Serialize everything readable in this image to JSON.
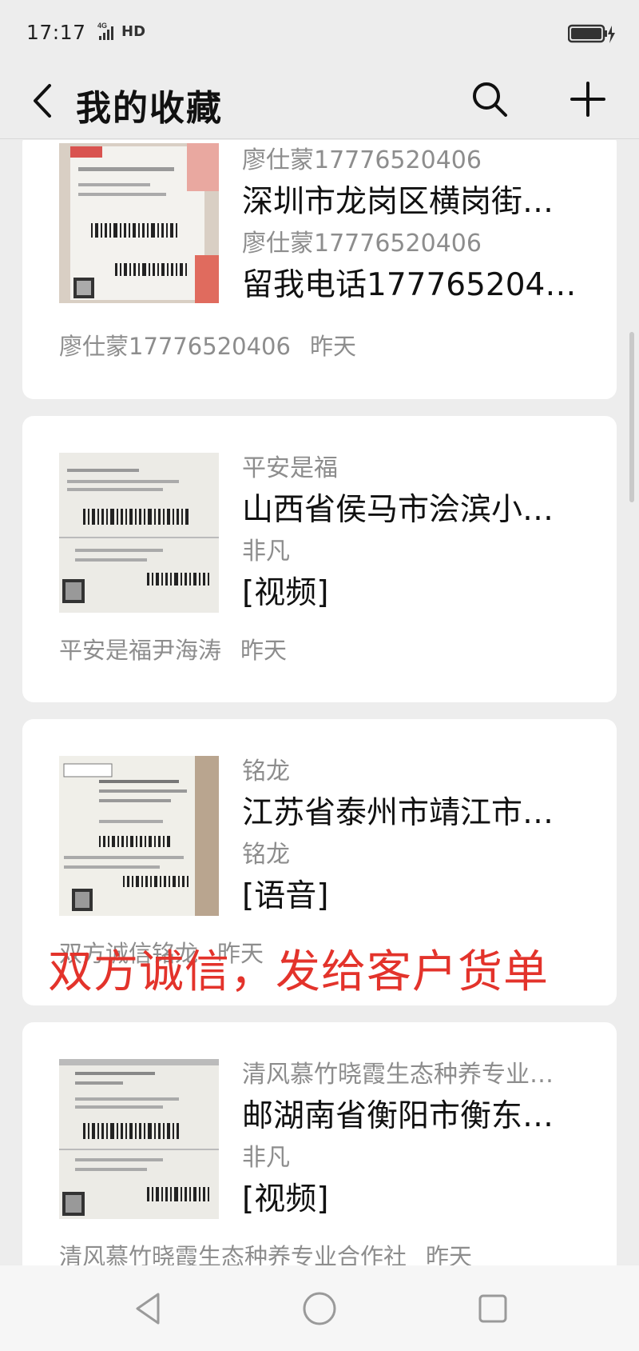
{
  "status_bar": {
    "time": "17:17",
    "network_badge": "4G",
    "network_label": "HD",
    "battery_icon": "battery-charging-icon"
  },
  "header": {
    "title": "我的收藏",
    "back_icon": "back-arrow-icon",
    "search_icon": "search-icon",
    "add_icon": "plus-icon"
  },
  "favorites": [
    {
      "thumbnail_icon": "express-waybill-thumbnail",
      "lines": [
        {
          "text": "廖仕蒙17776520406",
          "style": "sub"
        },
        {
          "text": "深圳市龙岗区横岗街…",
          "style": "main"
        },
        {
          "text": "廖仕蒙17776520406",
          "style": "sub"
        },
        {
          "text": "留我电话177765204…",
          "style": "main"
        }
      ],
      "source": "廖仕蒙17776520406",
      "time": "昨天"
    },
    {
      "thumbnail_icon": "express-waybill-thumbnail",
      "lines": [
        {
          "text": "平安是福",
          "style": "sub"
        },
        {
          "text": "山西省侯马市浍滨小…",
          "style": "main"
        },
        {
          "text": "非凡",
          "style": "sub"
        },
        {
          "text": "[视频]",
          "style": "main"
        }
      ],
      "source": "平安是福尹海涛",
      "time": "昨天"
    },
    {
      "thumbnail_icon": "express-waybill-thumbnail",
      "lines": [
        {
          "text": "铭龙",
          "style": "sub"
        },
        {
          "text": "江苏省泰州市靖江市…",
          "style": "main"
        },
        {
          "text": "铭龙",
          "style": "sub"
        },
        {
          "text": "[语音]",
          "style": "main"
        }
      ],
      "source": "双方诚信铭龙",
      "time": "昨天"
    },
    {
      "thumbnail_icon": "express-waybill-thumbnail",
      "lines": [
        {
          "text": "清风慕竹晓霞生态种养专业…",
          "style": "sub"
        },
        {
          "text": "邮湖南省衡阳市衡东…",
          "style": "main"
        },
        {
          "text": "非凡",
          "style": "sub"
        },
        {
          "text": "[视频]",
          "style": "main"
        }
      ],
      "source": "清风慕竹晓霞生态种养专业合作社",
      "time": "昨天"
    }
  ],
  "overlay_text": "双方诚信，发给客户货单",
  "nav": {
    "back_icon": "triangle-back-icon",
    "home_icon": "circle-home-icon",
    "recents_icon": "square-recents-icon"
  },
  "colors": {
    "background": "#ededed",
    "card": "#ffffff",
    "overlay_red": "#e3332b",
    "secondary_text": "#8d8d8d"
  }
}
